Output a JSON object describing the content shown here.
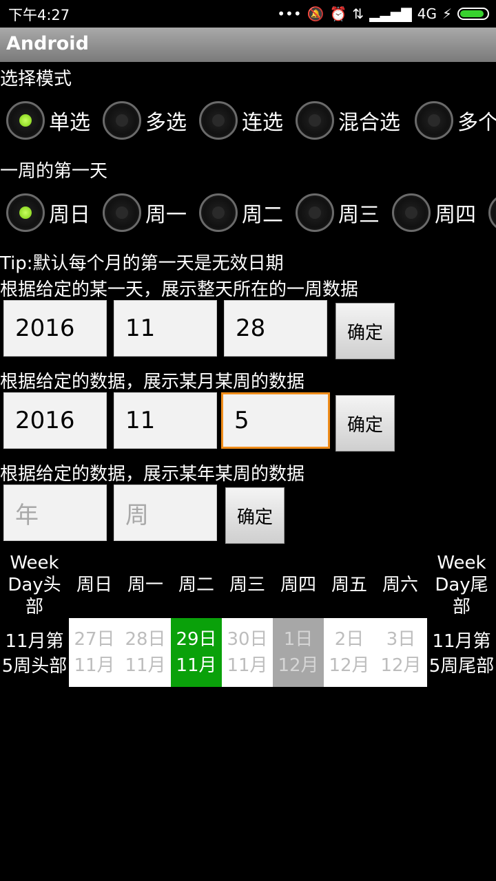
{
  "status_bar": {
    "time": "下午4:27",
    "network": "4G",
    "battery_color": "#37d12e"
  },
  "app": {
    "title": "Android"
  },
  "selection_mode": {
    "label": "选择模式",
    "options": [
      "单选",
      "多选",
      "连选",
      "混合选",
      "多个"
    ],
    "selected_index": 0
  },
  "first_day": {
    "label": "一周的第一天",
    "options": [
      "周日",
      "周一",
      "周二",
      "周三",
      "周四"
    ],
    "selected_index": 0
  },
  "tip": "Tip:默认每个月的第一天是无效日期",
  "section_day": {
    "label": "根据给定的某一天，展示整天所在的一周数据",
    "year": "2016",
    "month": "11",
    "day": "28",
    "confirm": "确定"
  },
  "section_month_week": {
    "label": "根据给定的数据，展示某月某周的数据",
    "year": "2016",
    "month": "11",
    "week": "5",
    "confirm": "确定"
  },
  "section_year_week": {
    "label": "根据给定的数据，展示某年某周的数据",
    "year_placeholder": "年",
    "week_placeholder": "周",
    "confirm": "确定"
  },
  "calendar": {
    "head_label": [
      "Week",
      "Day头",
      "部"
    ],
    "tail_label": [
      "Week",
      "Day尾",
      "部"
    ],
    "weekdays": [
      "周日",
      "周一",
      "周二",
      "周三",
      "周四",
      "周五",
      "周六"
    ],
    "week_head": [
      "11月第",
      "5周头部"
    ],
    "week_tail": [
      "11月第",
      "5周尾部"
    ],
    "days": [
      {
        "day": "27日",
        "month": "11月",
        "state": "normal"
      },
      {
        "day": "28日",
        "month": "11月",
        "state": "normal"
      },
      {
        "day": "29日",
        "month": "11月",
        "state": "selected"
      },
      {
        "day": "30日",
        "month": "11月",
        "state": "normal"
      },
      {
        "day": "1日",
        "month": "12月",
        "state": "disabled"
      },
      {
        "day": "2日",
        "month": "12月",
        "state": "normal"
      },
      {
        "day": "3日",
        "month": "12月",
        "state": "normal"
      }
    ],
    "selected_color": "#0aa10a",
    "disabled_color": "#a7a7a7"
  }
}
